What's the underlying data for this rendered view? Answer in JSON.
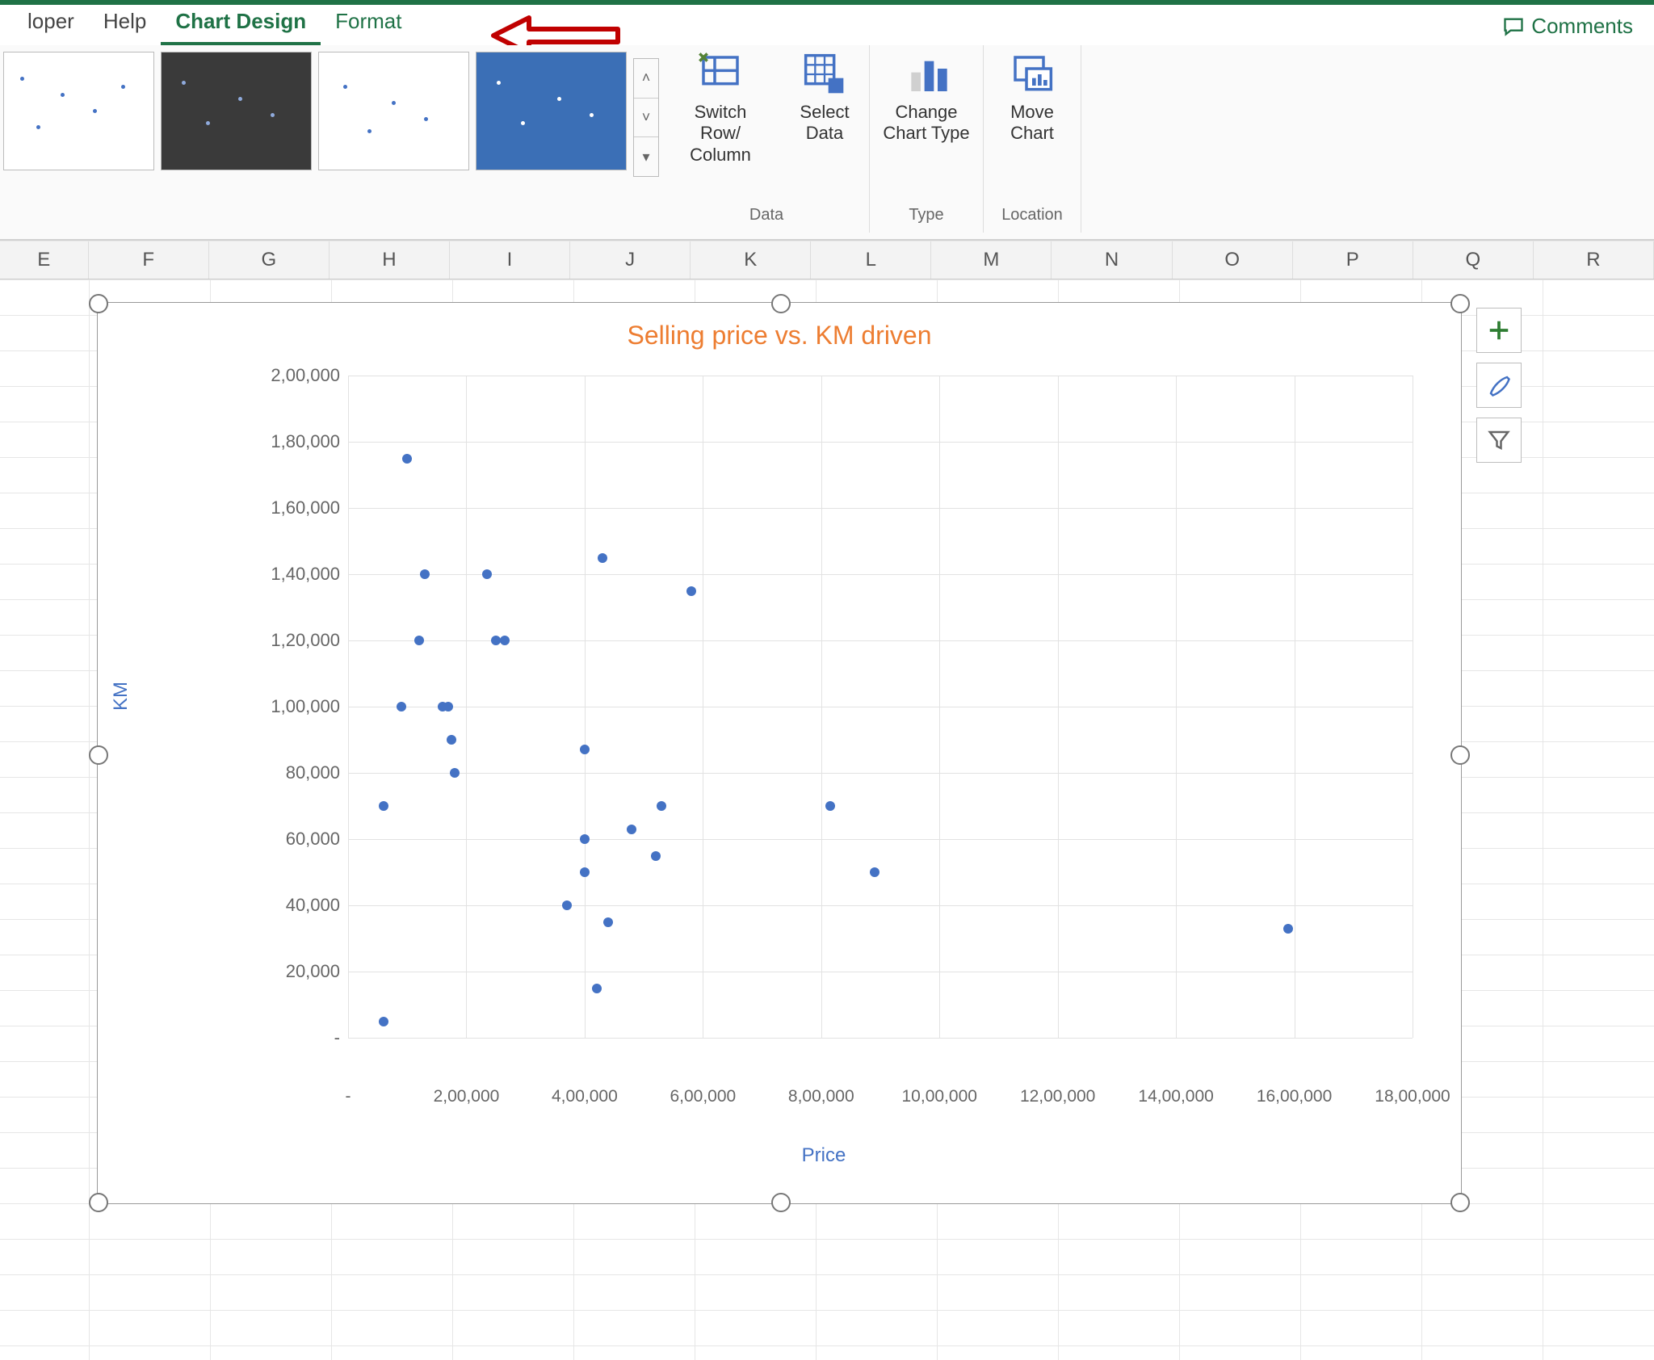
{
  "tabs": {
    "developer": "loper",
    "help": "Help",
    "chart_design": "Chart Design",
    "format": "Format"
  },
  "comments_label": "Comments",
  "ribbon": {
    "switch_row_column": "Switch Row/\nColumn",
    "select_data": "Select\nData",
    "change_chart_type": "Change\nChart Type",
    "move_chart": "Move\nChart",
    "group_data": "Data",
    "group_type": "Type",
    "group_location": "Location"
  },
  "columns": [
    "E",
    "F",
    "G",
    "H",
    "I",
    "J",
    "K",
    "L",
    "M",
    "N",
    "O",
    "P",
    "Q",
    "R"
  ],
  "chart_btns": {
    "plus": "+",
    "brush": "brush",
    "filter": "filter"
  },
  "chart_data": {
    "type": "scatter",
    "title": "Selling price vs. KM driven",
    "xlabel": "Price",
    "ylabel": "KM",
    "xlim": [
      0,
      1800000
    ],
    "ylim": [
      0,
      200000
    ],
    "xticks_values": [
      0,
      200000,
      400000,
      600000,
      800000,
      1000000,
      1200000,
      1400000,
      1600000,
      1800000
    ],
    "xticks_labels": [
      "-",
      "2,00,000",
      "4,00,000",
      "6,00,000",
      "8,00,000",
      "10,00,000",
      "12,00,000",
      "14,00,000",
      "16,00,000",
      "18,00,000"
    ],
    "yticks_values": [
      0,
      20000,
      40000,
      60000,
      80000,
      100000,
      120000,
      140000,
      160000,
      180000,
      200000
    ],
    "yticks_labels": [
      "-",
      "20,000",
      "40,000",
      "60,000",
      "80,000",
      "1,00,000",
      "1,20,000",
      "1,40,000",
      "1,60,000",
      "1,80,000",
      "2,00,000"
    ],
    "series": [
      {
        "name": "KM",
        "points": [
          [
            60000,
            5000
          ],
          [
            60000,
            70000
          ],
          [
            100000,
            175000
          ],
          [
            90000,
            100000
          ],
          [
            120000,
            120000
          ],
          [
            130000,
            140000
          ],
          [
            160000,
            100000
          ],
          [
            170000,
            100000
          ],
          [
            175000,
            90000
          ],
          [
            180000,
            80000
          ],
          [
            235000,
            140000
          ],
          [
            250000,
            120000
          ],
          [
            265000,
            120000
          ],
          [
            370000,
            40000
          ],
          [
            400000,
            60000
          ],
          [
            400000,
            50000
          ],
          [
            400000,
            87000
          ],
          [
            430000,
            145000
          ],
          [
            420000,
            15000
          ],
          [
            440000,
            35000
          ],
          [
            480000,
            63000
          ],
          [
            520000,
            55000
          ],
          [
            530000,
            70000
          ],
          [
            580000,
            135000
          ],
          [
            815000,
            70000
          ],
          [
            890000,
            50000
          ],
          [
            1590000,
            33000
          ]
        ]
      }
    ]
  }
}
